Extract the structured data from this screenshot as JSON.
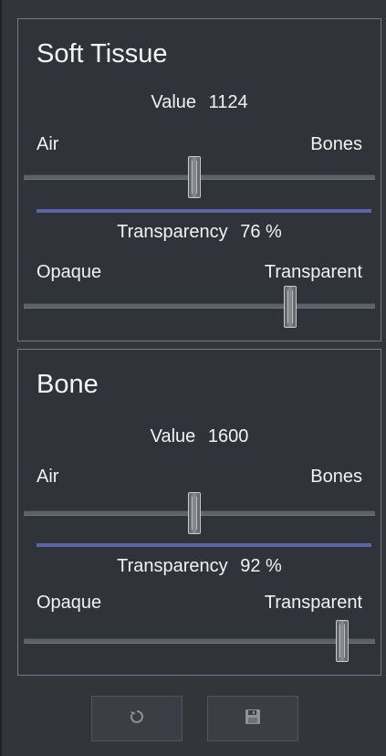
{
  "panels": [
    {
      "title": "Soft Tissue",
      "value_label": "Value",
      "value": "1124",
      "value_left_label": "Air",
      "value_right_label": "Bones",
      "value_slider_fraction": 0.48,
      "transparency_label": "Transparency",
      "transparency": "76 %",
      "transparency_left_label": "Opaque",
      "transparency_right_label": "Transparent",
      "transparency_fraction": 0.76
    },
    {
      "title": "Bone",
      "value_label": "Value",
      "value": "1600",
      "value_left_label": "Air",
      "value_right_label": "Bones",
      "value_slider_fraction": 0.48,
      "transparency_label": "Transparency",
      "transparency": "92 %",
      "transparency_left_label": "Opaque",
      "transparency_right_label": "Transparent",
      "transparency_fraction": 0.92
    }
  ],
  "footer": {
    "reset_icon": "reset-icon",
    "save_icon": "save-icon"
  },
  "colors": {
    "background": "#32363b",
    "accent_separator": "#5b65a6",
    "panel_border": "#767b82"
  }
}
